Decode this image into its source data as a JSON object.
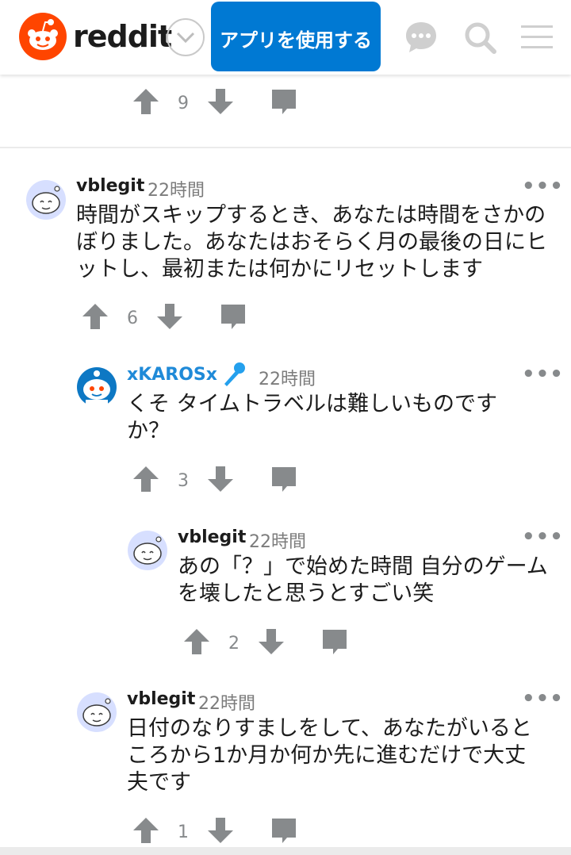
{
  "header": {
    "wordmark": "reddit",
    "app_button": "アプリを使用する",
    "colors": {
      "brand": "#ff4500",
      "button": "#0079d3"
    },
    "icons": [
      "reddit-logo",
      "chevron-down-icon",
      "chat-icon",
      "search-icon",
      "menu-icon"
    ]
  },
  "prev_comment": {
    "score": "9"
  },
  "comments": [
    {
      "username": "vblegit",
      "time": "22時間",
      "body": "時間がスキップするとき、あなたは時間をさかのぼりました。あなたはおそらく月の最後の日にヒットし、最初または何かにリセットします",
      "score": "6",
      "more": "•••"
    },
    {
      "username": "xKAROSx",
      "time": "22時間",
      "body": "くそ タイムトラベルは難しいものですか？",
      "score": "3",
      "more": "•••",
      "badge_icon": "microphone-icon"
    },
    {
      "username": "vblegit",
      "time": "22時間",
      "body": "あの「？」で始めた時間 自分のゲームを壊したと思うとすごい笑",
      "score": "2",
      "more": "•••"
    },
    {
      "username": "vblegit",
      "time": "22時間",
      "body": "日付のなりすましをして、あなたがいるところから1か月か何か先に進むだけで大丈夫です",
      "score": "1",
      "more": "•••"
    }
  ]
}
